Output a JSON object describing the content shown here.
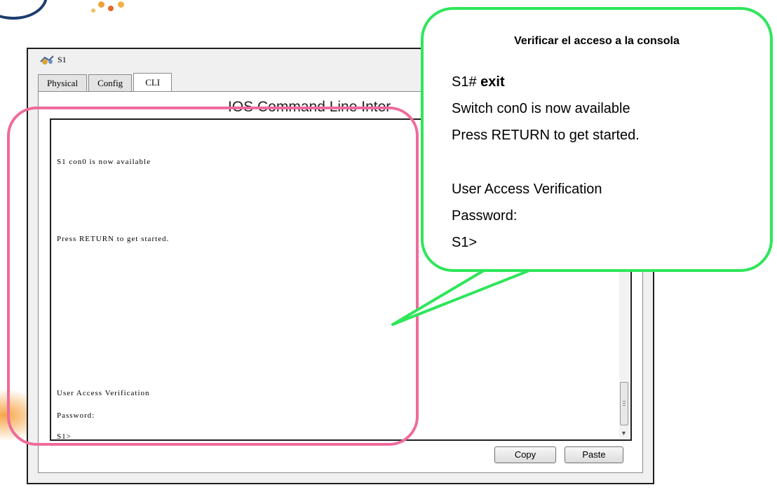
{
  "window": {
    "title": "S1",
    "tabs": [
      {
        "label": "Physical",
        "active": false
      },
      {
        "label": "Config",
        "active": false
      },
      {
        "label": "CLI",
        "active": true
      }
    ],
    "panel_title": "IOS Command Line Inter",
    "terminal_lines": [
      "S1 con0 is now available",
      "Press RETURN to get started.",
      "User Access Verification",
      "Password:",
      "S1>"
    ],
    "buttons": {
      "copy": "Copy",
      "paste": "Paste"
    }
  },
  "callout": {
    "title": "Verificar el acceso a la consola",
    "prompt": "S1#",
    "command": "exit",
    "lines": [
      "Switch con0 is now available",
      "Press RETURN to get started.",
      "User Access Verification",
      "Password:",
      "S1>"
    ]
  },
  "icons": [
    "switch-icon",
    "logo-arc",
    "logo-dots"
  ],
  "colors": {
    "highlight_border": "#ef6b9b",
    "callout_border": "#2ee65a",
    "window_border": "#1f1f1f",
    "panel_background": "#ffffff"
  }
}
